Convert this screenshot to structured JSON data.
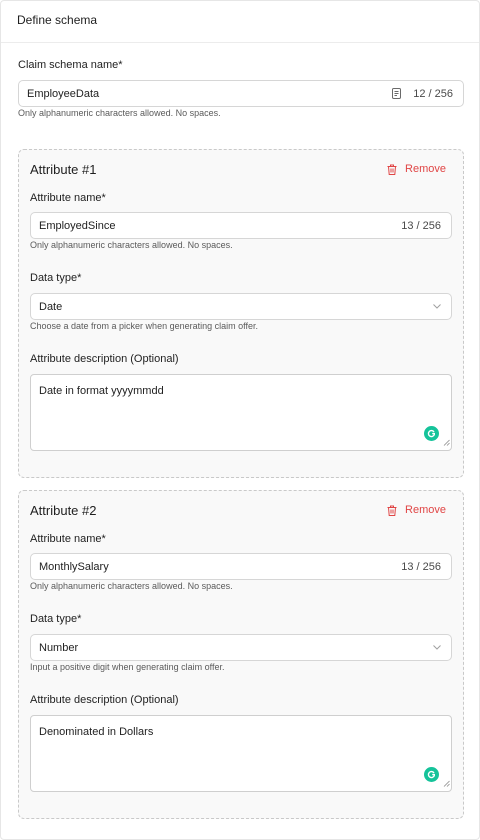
{
  "header": {
    "title": "Define schema"
  },
  "schema": {
    "label": "Claim schema name*",
    "value": "EmployeeData",
    "counter": "12 / 256",
    "help": "Only alphanumeric characters allowed. No spaces."
  },
  "attributes": [
    {
      "title": "Attribute #1",
      "remove_label": "Remove",
      "name_label": "Attribute name*",
      "name_value": "EmployedSince",
      "name_counter": "13 / 256",
      "name_help": "Only alphanumeric characters allowed. No spaces.",
      "type_label": "Data type*",
      "type_value": "Date",
      "type_help": "Choose a date from a picker when generating claim offer.",
      "desc_label": "Attribute description (Optional)",
      "desc_value": "Date in format yyyymmdd"
    },
    {
      "title": "Attribute #2",
      "remove_label": "Remove",
      "name_label": "Attribute name*",
      "name_value": "MonthlySalary",
      "name_counter": "13 / 256",
      "name_help": "Only alphanumeric characters allowed. No spaces.",
      "type_label": "Data type*",
      "type_value": "Number",
      "type_help": "Input a positive digit when generating claim offer.",
      "desc_label": "Attribute description (Optional)",
      "desc_value": "Denominated in Dollars"
    }
  ],
  "colors": {
    "remove": "#e04545",
    "grammarly": "#15c39a",
    "border": "#d6d6d6",
    "attr_bg": "#f9f9f9"
  },
  "icons": {
    "remove": "trash-icon",
    "select": "chevron-down-icon",
    "input_action": "clipboard-icon",
    "assistant": "grammarly-icon"
  }
}
